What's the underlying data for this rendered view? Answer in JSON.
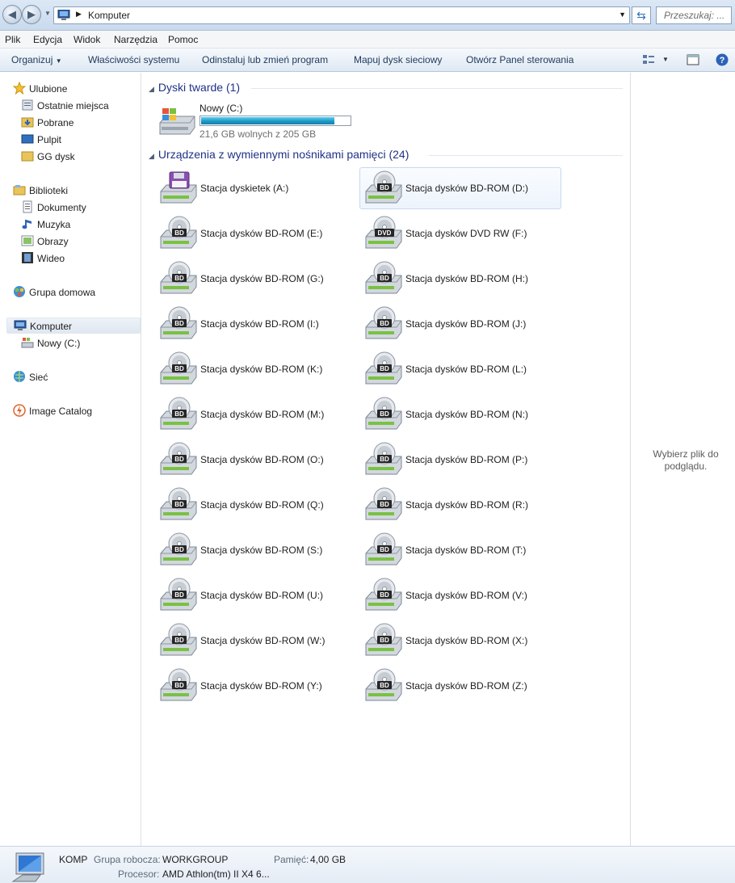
{
  "address": {
    "crumb": "Komputer",
    "search_placeholder": "Przeszukaj: ..."
  },
  "menu": [
    "Plik",
    "Edycja",
    "Widok",
    "Narzędzia",
    "Pomoc"
  ],
  "toolbar": {
    "organize": "Organizuj",
    "system_props": "Właściwości systemu",
    "uninstall": "Odinstaluj lub zmień program",
    "map_drive": "Mapuj dysk sieciowy",
    "control_panel": "Otwórz Panel sterowania"
  },
  "nav": {
    "favorites": "Ulubione",
    "recent": "Ostatnie miejsca",
    "downloads": "Pobrane",
    "desktop": "Pulpit",
    "gg": "GG dysk",
    "libraries": "Biblioteki",
    "documents": "Dokumenty",
    "music": "Muzyka",
    "pictures": "Obrazy",
    "videos": "Wideo",
    "homegroup": "Grupa domowa",
    "computer": "Komputer",
    "drive_c": "Nowy (C:)",
    "network": "Sieć",
    "image_catalog": "Image Catalog"
  },
  "sections": {
    "hdd": "Dyski twarde (1)",
    "removable": "Urządzenia z wymiennymi nośnikami pamięci (24)"
  },
  "hdd": {
    "name": "Nowy (C:)",
    "free": "21,6 GB wolnych z 205 GB",
    "used_fraction": 0.895
  },
  "drives": [
    {
      "name": "Stacja dyskietek (A:)",
      "kind": "floppy"
    },
    {
      "name": "Stacja dysków BD-ROM (D:)",
      "kind": "bd"
    },
    {
      "name": "Stacja dysków BD-ROM (E:)",
      "kind": "bd"
    },
    {
      "name": "Stacja dysków DVD RW (F:)",
      "kind": "dvd"
    },
    {
      "name": "Stacja dysków BD-ROM (G:)",
      "kind": "bd"
    },
    {
      "name": "Stacja dysków BD-ROM (H:)",
      "kind": "bd"
    },
    {
      "name": "Stacja dysków BD-ROM (I:)",
      "kind": "bd"
    },
    {
      "name": "Stacja dysków BD-ROM (J:)",
      "kind": "bd"
    },
    {
      "name": "Stacja dysków BD-ROM (K:)",
      "kind": "bd"
    },
    {
      "name": "Stacja dysków BD-ROM (L:)",
      "kind": "bd"
    },
    {
      "name": "Stacja dysków BD-ROM (M:)",
      "kind": "bd"
    },
    {
      "name": "Stacja dysków BD-ROM (N:)",
      "kind": "bd"
    },
    {
      "name": "Stacja dysków BD-ROM (O:)",
      "kind": "bd"
    },
    {
      "name": "Stacja dysków BD-ROM (P:)",
      "kind": "bd"
    },
    {
      "name": "Stacja dysków BD-ROM (Q:)",
      "kind": "bd"
    },
    {
      "name": "Stacja dysków BD-ROM (R:)",
      "kind": "bd"
    },
    {
      "name": "Stacja dysków BD-ROM (S:)",
      "kind": "bd"
    },
    {
      "name": "Stacja dysków BD-ROM (T:)",
      "kind": "bd"
    },
    {
      "name": "Stacja dysków BD-ROM (U:)",
      "kind": "bd"
    },
    {
      "name": "Stacja dysków BD-ROM (V:)",
      "kind": "bd"
    },
    {
      "name": "Stacja dysków BD-ROM (W:)",
      "kind": "bd"
    },
    {
      "name": "Stacja dysków BD-ROM (X:)",
      "kind": "bd"
    },
    {
      "name": "Stacja dysków BD-ROM (Y:)",
      "kind": "bd"
    },
    {
      "name": "Stacja dysków BD-ROM (Z:)",
      "kind": "bd"
    }
  ],
  "preview_msg": "Wybierz plik do podglądu.",
  "details": {
    "name": "KOMP",
    "workgroup_label": "Grupa robocza:",
    "workgroup": "WORKGROUP",
    "memory_label": "Pamięć:",
    "memory": "4,00 GB",
    "cpu_label": "Procesor:",
    "cpu": "AMD Athlon(tm) II X4 6..."
  }
}
